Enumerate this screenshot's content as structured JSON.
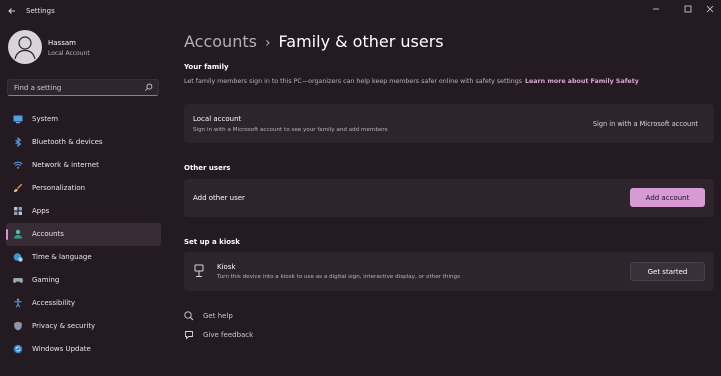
{
  "window": {
    "title": "Settings",
    "controls": [
      "minimize",
      "maximize",
      "close"
    ]
  },
  "user": {
    "name": "Hassam",
    "account_type": "Local Account"
  },
  "search": {
    "placeholder": "Find a setting"
  },
  "sidebar": {
    "items": [
      {
        "label": "System",
        "icon": "monitor-icon"
      },
      {
        "label": "Bluetooth & devices",
        "icon": "bluetooth-icon"
      },
      {
        "label": "Network & internet",
        "icon": "wifi-icon"
      },
      {
        "label": "Personalization",
        "icon": "brush-icon"
      },
      {
        "label": "Apps",
        "icon": "apps-icon"
      },
      {
        "label": "Accounts",
        "icon": "person-icon",
        "active": true
      },
      {
        "label": "Time & language",
        "icon": "globe-clock-icon"
      },
      {
        "label": "Gaming",
        "icon": "gamepad-icon"
      },
      {
        "label": "Accessibility",
        "icon": "accessibility-icon"
      },
      {
        "label": "Privacy & security",
        "icon": "shield-icon"
      },
      {
        "label": "Windows Update",
        "icon": "update-icon"
      }
    ]
  },
  "breadcrumb": {
    "parent": "Accounts",
    "separator": "›",
    "current": "Family & other users"
  },
  "your_family": {
    "title": "Your family",
    "description": "Let family members sign in to this PC—organizers can help keep members safer online with safety settings",
    "link": "Learn more about Family Safety",
    "card": {
      "title": "Local account",
      "subtitle": "Sign in with a Microsoft account to see your family and add members",
      "action": "Sign in with a Microsoft account"
    }
  },
  "other_users": {
    "title": "Other users",
    "card": {
      "label": "Add other user",
      "button": "Add account"
    }
  },
  "kiosk": {
    "title": "Set up a kiosk",
    "card": {
      "title": "Kiosk",
      "subtitle": "Turn this device into a kiosk to use as a digital sign, interactive display, or other things",
      "button": "Get started"
    }
  },
  "help": {
    "get_help": "Get help",
    "give_feedback": "Give feedback"
  },
  "colors": {
    "background": "#241a22",
    "card": "#2d242c",
    "accent": "#d79ad5",
    "link": "#dca6d9",
    "active_nav": "#372c36"
  }
}
